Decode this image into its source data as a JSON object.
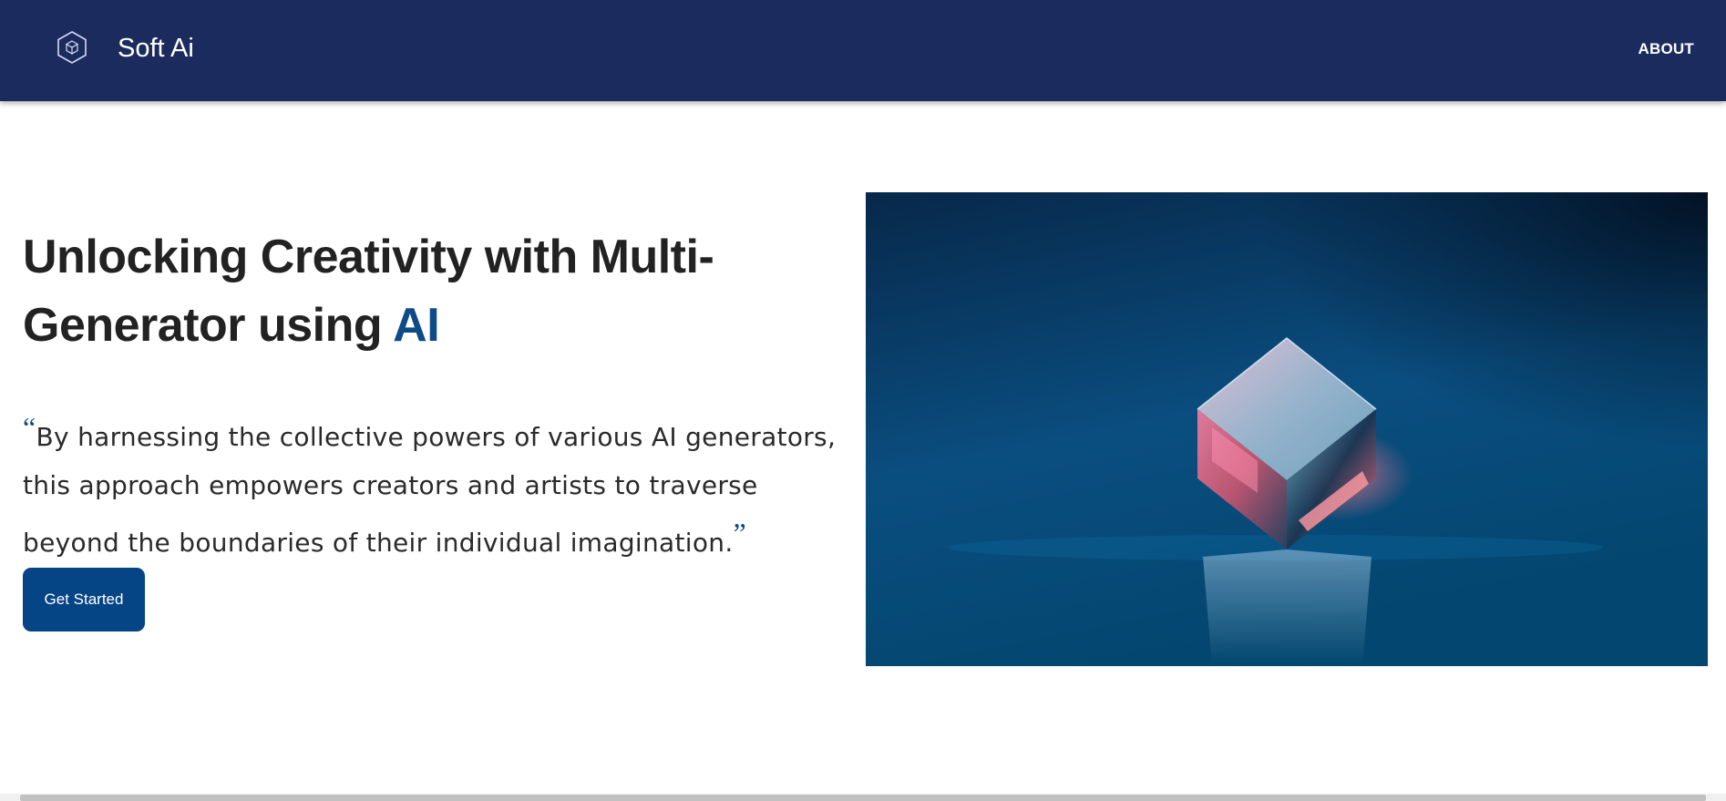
{
  "navbar": {
    "brand": "Soft Ai",
    "logo_icon": "cube-hexagon-icon",
    "about_label": "ABOUT",
    "background_color": "#1c2b5e"
  },
  "hero": {
    "title_line1": "Unlocking Creativity with Multi-",
    "title_line2_prefix": "Generator using ",
    "title_accent": "AI",
    "quote_open": "“",
    "quote_text": "By harnessing the collective powers of various AI generators, this approach empowers creators and artists to traverse beyond the boundaries of their individual imagination.",
    "quote_close": "”",
    "cta_label": "Get Started",
    "accent_color": "#0d4b86",
    "image_icon": "glass-cube-image"
  }
}
